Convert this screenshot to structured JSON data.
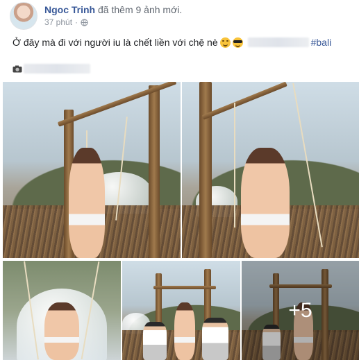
{
  "post": {
    "author": "Ngoc Trinh",
    "action": "đã thêm 9 ảnh mới.",
    "time": "37 phút",
    "privacy_icon": "globe-icon",
    "caption": "Ở đây mà đi với người iu là chết liền với chệ nè",
    "emoji_1": "smiling-face-icon",
    "emoji_2": "sunglasses-face-icon",
    "hashtag": "#bali",
    "line2_icon": "camera-icon"
  },
  "gallery": {
    "photos": [
      {
        "id": 1,
        "subject": "woman-on-swing"
      },
      {
        "id": 2,
        "subject": "woman-on-swing"
      },
      {
        "id": 3,
        "subject": "woman-on-swing"
      },
      {
        "id": 4,
        "subject": "group-at-swing"
      },
      {
        "id": 5,
        "subject": "group-at-swing"
      }
    ],
    "more_count": "+5"
  },
  "colors": {
    "link": "#385898",
    "meta": "#8d949e"
  }
}
